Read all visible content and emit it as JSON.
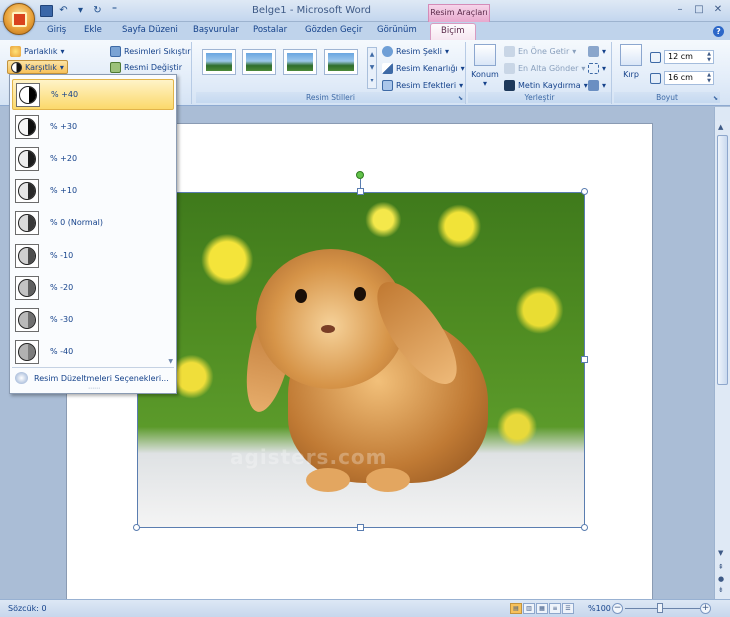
{
  "window": {
    "title": "Belge1 - Microsoft Word",
    "context_tab": "Resim Araçları"
  },
  "tabs": [
    {
      "label": "Giriş"
    },
    {
      "label": "Ekle"
    },
    {
      "label": "Sayfa Düzeni"
    },
    {
      "label": "Başvurular"
    },
    {
      "label": "Postalar"
    },
    {
      "label": "Gözden Geçir"
    },
    {
      "label": "Görünüm"
    },
    {
      "label": "Biçim",
      "active": true
    }
  ],
  "ribbon": {
    "adjust": {
      "brightness": "Parlaklık",
      "contrast": "Karşıtlık",
      "compress": "Resimleri Sıkıştır",
      "change": "Resmi Değiştir"
    },
    "styles": {
      "group_label": "Resim Stilleri",
      "shape": "Resim Şekli",
      "border": "Resim Kenarlığı",
      "effects": "Resim Efektleri"
    },
    "arrange": {
      "group_label": "Yerleştir",
      "position": "Konum",
      "bring_front": "En Öne Getir",
      "send_back": "En Alta Gönder",
      "text_wrap": "Metin Kaydırma"
    },
    "size": {
      "group_label": "Boyut",
      "crop": "Kırp",
      "height": "12 cm",
      "width": "16 cm"
    }
  },
  "contrast_menu": {
    "items": [
      {
        "label": "% +40",
        "selected": true,
        "dark_fraction": 1.0
      },
      {
        "label": "% +30",
        "dark_fraction": 0.92
      },
      {
        "label": "% +20",
        "dark_fraction": 0.85
      },
      {
        "label": "% +10",
        "dark_fraction": 0.78
      },
      {
        "label": "% 0 (Normal)",
        "dark_fraction": 0.7
      },
      {
        "label": "% -10",
        "dark_fraction": 0.6
      },
      {
        "label": "% -20",
        "dark_fraction": 0.5
      },
      {
        "label": "% -30",
        "dark_fraction": 0.42
      },
      {
        "label": "% -40",
        "dark_fraction": 0.35
      }
    ],
    "footer": "Resim Düzeltmeleri Seçenekleri..."
  },
  "document": {
    "watermark": "agisters.com"
  },
  "status": {
    "word_count": "Sözcük: 0",
    "zoom": "%100"
  },
  "colors": {
    "ribbon_bg": "#e3edf9",
    "context_pink": "#e8a8cd",
    "selected_item": "#fbd96b",
    "text_blue": "#15428b"
  }
}
